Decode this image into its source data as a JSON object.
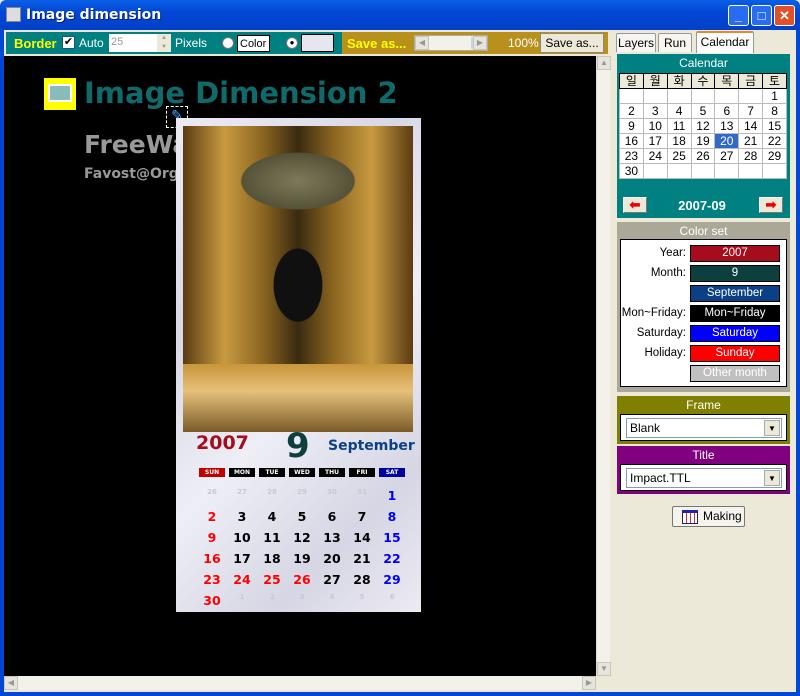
{
  "window": {
    "title": "Image dimension",
    "min": "_",
    "max": "□",
    "close": "✕"
  },
  "toolbar": {
    "border_label": "Border",
    "auto_label": "Auto",
    "auto_checked": true,
    "pixels_value": "25",
    "pixels_label": "Pixels",
    "color_label": "Color",
    "save_label": "Save as...",
    "zoom_percent": "100%",
    "save_button": "Save as...",
    "zoom_slider_fraction": 0.85
  },
  "canvas": {
    "heading": "Image Dimension 2",
    "line2": "FreeWa",
    "line3": "Favost@Org",
    "heading_color": "#0f6b6b"
  },
  "poster": {
    "year": "2007",
    "month_num": "9",
    "month_name": "September",
    "weekdays": [
      "SUN",
      "MON",
      "TUE",
      "WED",
      "THU",
      "FRI",
      "SAT"
    ],
    "weeks": [
      [
        "26",
        "27",
        "28",
        "29",
        "30",
        "31",
        "1"
      ],
      [
        "2",
        "3",
        "4",
        "5",
        "6",
        "7",
        "8"
      ],
      [
        "9",
        "10",
        "11",
        "12",
        "13",
        "14",
        "15"
      ],
      [
        "16",
        "17",
        "18",
        "19",
        "20",
        "21",
        "22"
      ],
      [
        "23",
        "24",
        "25",
        "26",
        "27",
        "28",
        "29"
      ],
      [
        "30",
        "1",
        "2",
        "3",
        "4",
        "5",
        "6"
      ]
    ],
    "holidays": [
      "24",
      "25",
      "26"
    ]
  },
  "tabs": [
    {
      "label": "Layers"
    },
    {
      "label": "Run"
    },
    {
      "label": "Calendar",
      "active": true
    }
  ],
  "calendar": {
    "title": "Calendar",
    "weekdays": [
      "일",
      "월",
      "화",
      "수",
      "목",
      "금",
      "토"
    ],
    "weeks": [
      [
        "",
        "",
        "",
        "",
        "",
        "",
        "1"
      ],
      [
        "2",
        "3",
        "4",
        "5",
        "6",
        "7",
        "8"
      ],
      [
        "9",
        "10",
        "11",
        "12",
        "13",
        "14",
        "15"
      ],
      [
        "16",
        "17",
        "18",
        "19",
        "20",
        "21",
        "22"
      ],
      [
        "23",
        "24",
        "25",
        "26",
        "27",
        "28",
        "29"
      ],
      [
        "30",
        "",
        "",
        "",
        "",
        "",
        ""
      ]
    ],
    "selected": "20",
    "month": "2007-09",
    "prev": "⬅",
    "next": "➡"
  },
  "colorset": {
    "title": "Color set",
    "rows": [
      {
        "label": "Year:",
        "value": "2007",
        "color": "#a50d1c"
      },
      {
        "label": "Month:",
        "value": "9",
        "color": "#0d3f3f"
      },
      {
        "label": "",
        "value": "September",
        "color": "#0b3f86"
      },
      {
        "label": "Mon~Friday:",
        "value": "Mon~Friday",
        "color": "#000000"
      },
      {
        "label": "Saturday:",
        "value": "Saturday",
        "color": "#0000ff"
      },
      {
        "label": "Holiday:",
        "value": "Sunday",
        "color": "#ff0000"
      },
      {
        "label": "",
        "value": "Other month",
        "color": "#c0c0c0"
      }
    ]
  },
  "frame": {
    "title": "Frame",
    "value": "Blank"
  },
  "title_section": {
    "title": "Title",
    "value": "Impact.TTL"
  },
  "making_button": "Making"
}
